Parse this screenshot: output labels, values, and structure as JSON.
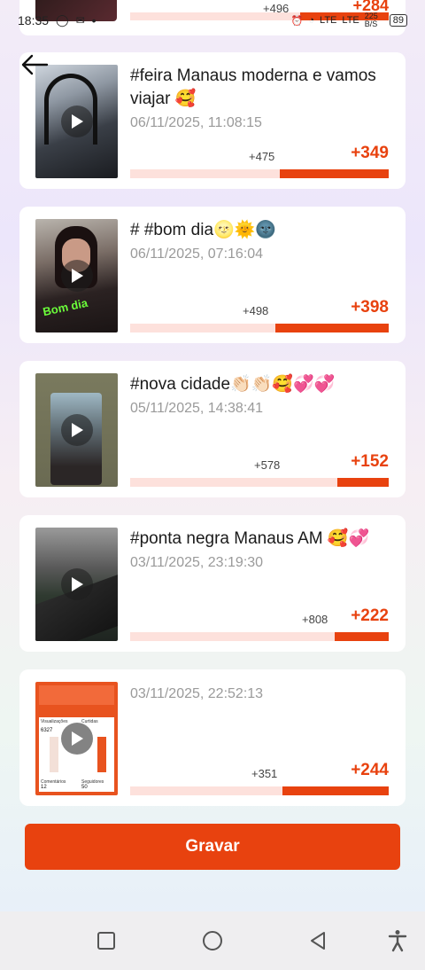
{
  "status": {
    "time": "18:35",
    "battery": "89",
    "network_labels": [
      "LTE",
      "LTE"
    ],
    "speed": "225 B/S"
  },
  "partial_item": {
    "small_value": "+496",
    "big_value": "+284"
  },
  "videos": [
    {
      "title": "#feira Manaus moderna e vamos viajar 🥰",
      "date": "06/11/2025, 11:08:15",
      "small_value": "+475",
      "big_value": "+349",
      "fill_fraction": 0.42
    },
    {
      "title": "# #bom dia🌝🌞🌚",
      "date": "06/11/2025, 07:16:04",
      "small_value": "+498",
      "big_value": "+398",
      "fill_fraction": 0.44
    },
    {
      "title": "#nova cidade👏🏻👏🏻🥰💞💞",
      "date": "05/11/2025, 14:38:41",
      "small_value": "+578",
      "big_value": "+152",
      "fill_fraction": 0.2
    },
    {
      "title": "#ponta negra Manaus AM 🥰💞",
      "date": "03/11/2025, 23:19:30",
      "small_value": "+808",
      "big_value": "+222",
      "fill_fraction": 0.21
    },
    {
      "title": "",
      "date": "03/11/2025, 22:52:13",
      "small_value": "+351",
      "big_value": "+244",
      "fill_fraction": 0.41
    }
  ],
  "thumb_overlay": {
    "bom_dia_text": "Bom dia",
    "stats_labels": [
      "Visualizações",
      "Curtidas",
      "Comentários",
      "Seguidores"
    ],
    "stats_values": [
      "6327",
      "12",
      "50"
    ]
  },
  "record_button": "Gravar",
  "colors": {
    "accent": "#e8420f",
    "bar_bg": "#fde1dc"
  }
}
